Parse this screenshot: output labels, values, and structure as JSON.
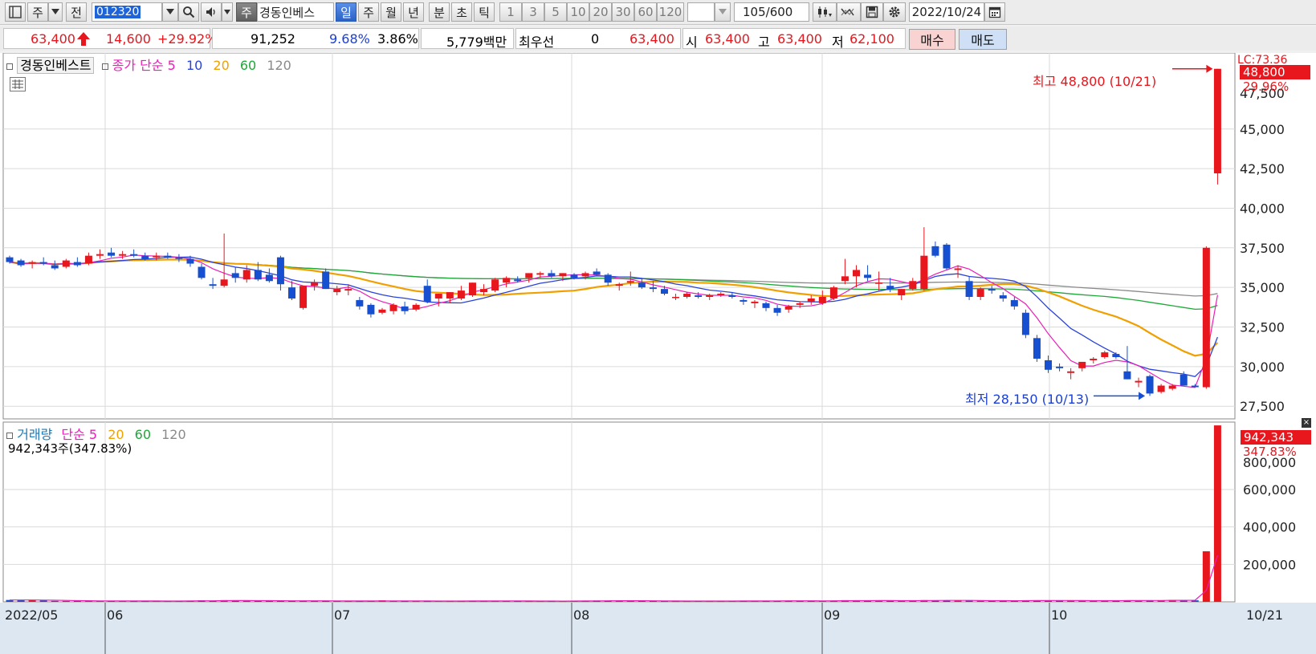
{
  "toolbar": {
    "market_type": "주",
    "scope": "전",
    "stock_code": "012320",
    "tag": "주",
    "stock_name": "경동인베스",
    "periods": [
      "일",
      "주",
      "월",
      "년",
      "분",
      "초",
      "틱"
    ],
    "active_period": "일",
    "intervals": [
      "1",
      "3",
      "5",
      "10",
      "20",
      "30",
      "60",
      "120"
    ],
    "count": "105",
    "max": "/600",
    "date": "2022/10/24"
  },
  "quote": {
    "price": "63,400",
    "change": "14,600",
    "change_pct": "+29.92%",
    "volume": "91,252",
    "vol_ratio": "9.68%",
    "turnover": "3.86%",
    "amount": "5,779백만",
    "best_label": "최우선",
    "best_value": "0",
    "bid_price": "63,400",
    "open_label": "시",
    "open": "63,400",
    "high_label": "고",
    "high": "63,400",
    "low_label": "저",
    "low": "62,100",
    "buy_label": "매수",
    "sell_label": "매도"
  },
  "price_panel": {
    "name": "경동인베스트",
    "ma_label": "종가 단순",
    "ma_periods": [
      "5",
      "10",
      "20",
      "60",
      "120"
    ],
    "high_annotation": "최고 48,800 (10/21)",
    "low_annotation": "최저 28,150 (10/13)",
    "axis_overflow_label": "LC:73.36",
    "badge_price": "48,800",
    "badge_pct": "29.96%"
  },
  "volume_panel": {
    "name": "거래량",
    "ma_label": "단순",
    "ma_periods": [
      "5",
      "20",
      "60",
      "120"
    ],
    "current": "942,343주(347.83%)",
    "badge_value": "942,343",
    "badge_pct": "347.83%"
  },
  "colors": {
    "up": "#e8161d",
    "down": "#1650d0",
    "ma5": "#e820b8",
    "ma10": "#2a44d8",
    "ma20": "#f0a000",
    "ma60": "#1fa838",
    "ma120": "#8a8a8a"
  },
  "chart_data": {
    "type": "candlestick",
    "price_axis": {
      "ticks": [
        27500,
        30000,
        32500,
        35000,
        37500,
        40000,
        42500,
        45000
      ],
      "top_partial_label": "47,500",
      "ylim": [
        26700,
        49800
      ]
    },
    "volume_axis": {
      "ticks": [
        200000,
        400000,
        600000
      ],
      "top_partial_label": "800,000",
      "ylim": [
        0,
        960000
      ]
    },
    "x_labels": [
      "2022/05",
      "06",
      "07",
      "08",
      "09",
      "10",
      "10/21"
    ],
    "candles": [
      {
        "o": 36900,
        "h": 37000,
        "l": 36500,
        "c": 36600
      },
      {
        "o": 36700,
        "h": 36800,
        "l": 36300,
        "c": 36400
      },
      {
        "o": 36500,
        "h": 36700,
        "l": 36200,
        "c": 36600
      },
      {
        "o": 36600,
        "h": 36900,
        "l": 36400,
        "c": 36500
      },
      {
        "o": 36400,
        "h": 36700,
        "l": 36100,
        "c": 36200
      },
      {
        "o": 36300,
        "h": 36800,
        "l": 36200,
        "c": 36700
      },
      {
        "o": 36600,
        "h": 36900,
        "l": 36300,
        "c": 36400
      },
      {
        "o": 36500,
        "h": 37200,
        "l": 36400,
        "c": 37000
      },
      {
        "o": 37000,
        "h": 37400,
        "l": 36800,
        "c": 37100
      },
      {
        "o": 37200,
        "h": 37500,
        "l": 36900,
        "c": 37000
      },
      {
        "o": 37000,
        "h": 37300,
        "l": 36800,
        "c": 37100
      },
      {
        "o": 37100,
        "h": 37400,
        "l": 36900,
        "c": 37000
      },
      {
        "o": 37000,
        "h": 37200,
        "l": 36700,
        "c": 36800
      },
      {
        "o": 36900,
        "h": 37200,
        "l": 36700,
        "c": 37000
      },
      {
        "o": 37000,
        "h": 37200,
        "l": 36800,
        "c": 36900
      },
      {
        "o": 36900,
        "h": 37100,
        "l": 36600,
        "c": 36800
      },
      {
        "o": 36800,
        "h": 37000,
        "l": 36300,
        "c": 36500
      },
      {
        "o": 36300,
        "h": 36500,
        "l": 35500,
        "c": 35600
      },
      {
        "o": 35200,
        "h": 35600,
        "l": 34900,
        "c": 35100
      },
      {
        "o": 35100,
        "h": 38400,
        "l": 35000,
        "c": 35500
      },
      {
        "o": 35900,
        "h": 36300,
        "l": 35300,
        "c": 35600
      },
      {
        "o": 35500,
        "h": 36400,
        "l": 35300,
        "c": 36100
      },
      {
        "o": 36100,
        "h": 36600,
        "l": 35400,
        "c": 35500
      },
      {
        "o": 35800,
        "h": 36200,
        "l": 35300,
        "c": 35400
      },
      {
        "o": 36900,
        "h": 37000,
        "l": 34800,
        "c": 35200
      },
      {
        "o": 35000,
        "h": 35400,
        "l": 34200,
        "c": 34300
      },
      {
        "o": 33700,
        "h": 35100,
        "l": 33600,
        "c": 35100
      },
      {
        "o": 35100,
        "h": 35500,
        "l": 34800,
        "c": 35300
      },
      {
        "o": 36000,
        "h": 36200,
        "l": 34900,
        "c": 34900
      },
      {
        "o": 34700,
        "h": 35100,
        "l": 34500,
        "c": 34900
      },
      {
        "o": 34800,
        "h": 35200,
        "l": 34500,
        "c": 34900
      },
      {
        "o": 34200,
        "h": 34400,
        "l": 33600,
        "c": 33800
      },
      {
        "o": 33900,
        "h": 34000,
        "l": 33100,
        "c": 33300
      },
      {
        "o": 33400,
        "h": 33700,
        "l": 33300,
        "c": 33600
      },
      {
        "o": 33500,
        "h": 34000,
        "l": 33300,
        "c": 33900
      },
      {
        "o": 33800,
        "h": 34100,
        "l": 33300,
        "c": 33500
      },
      {
        "o": 33600,
        "h": 34000,
        "l": 33500,
        "c": 33900
      },
      {
        "o": 35100,
        "h": 35500,
        "l": 34000,
        "c": 34100
      },
      {
        "o": 34300,
        "h": 34600,
        "l": 33800,
        "c": 34600
      },
      {
        "o": 34300,
        "h": 34700,
        "l": 34000,
        "c": 34700
      },
      {
        "o": 34300,
        "h": 35100,
        "l": 34200,
        "c": 34800
      },
      {
        "o": 34500,
        "h": 35300,
        "l": 34400,
        "c": 35300
      },
      {
        "o": 34700,
        "h": 35200,
        "l": 34500,
        "c": 34900
      },
      {
        "o": 34800,
        "h": 35600,
        "l": 34700,
        "c": 35500
      },
      {
        "o": 35300,
        "h": 35700,
        "l": 35000,
        "c": 35600
      },
      {
        "o": 35500,
        "h": 35700,
        "l": 35300,
        "c": 35400
      },
      {
        "o": 35600,
        "h": 35900,
        "l": 35300,
        "c": 35900
      },
      {
        "o": 35800,
        "h": 36000,
        "l": 35600,
        "c": 35900
      },
      {
        "o": 35900,
        "h": 36100,
        "l": 35600,
        "c": 35700
      },
      {
        "o": 35700,
        "h": 35900,
        "l": 35400,
        "c": 35900
      },
      {
        "o": 35800,
        "h": 35900,
        "l": 35500,
        "c": 35600
      },
      {
        "o": 35700,
        "h": 36000,
        "l": 35500,
        "c": 35900
      },
      {
        "o": 36000,
        "h": 36200,
        "l": 35700,
        "c": 35800
      },
      {
        "o": 35800,
        "h": 35900,
        "l": 35100,
        "c": 35300
      },
      {
        "o": 35100,
        "h": 35300,
        "l": 34800,
        "c": 35200
      },
      {
        "o": 35300,
        "h": 36000,
        "l": 35100,
        "c": 35400
      },
      {
        "o": 35300,
        "h": 35600,
        "l": 34900,
        "c": 35000
      },
      {
        "o": 35000,
        "h": 35400,
        "l": 34700,
        "c": 34900
      },
      {
        "o": 34900,
        "h": 35100,
        "l": 34500,
        "c": 34600
      },
      {
        "o": 34400,
        "h": 34600,
        "l": 34200,
        "c": 34400
      },
      {
        "o": 34400,
        "h": 34700,
        "l": 34300,
        "c": 34600
      },
      {
        "o": 34500,
        "h": 34700,
        "l": 34300,
        "c": 34400
      },
      {
        "o": 34400,
        "h": 34600,
        "l": 34200,
        "c": 34500
      },
      {
        "o": 34500,
        "h": 34700,
        "l": 34400,
        "c": 34600
      },
      {
        "o": 34500,
        "h": 34700,
        "l": 34300,
        "c": 34400
      },
      {
        "o": 34200,
        "h": 34300,
        "l": 33900,
        "c": 34100
      },
      {
        "o": 34000,
        "h": 34200,
        "l": 33700,
        "c": 34100
      },
      {
        "o": 34000,
        "h": 34100,
        "l": 33500,
        "c": 33700
      },
      {
        "o": 33700,
        "h": 33900,
        "l": 33200,
        "c": 33400
      },
      {
        "o": 33600,
        "h": 33900,
        "l": 33400,
        "c": 33800
      },
      {
        "o": 33900,
        "h": 34100,
        "l": 33700,
        "c": 34000
      },
      {
        "o": 34100,
        "h": 34500,
        "l": 33900,
        "c": 34300
      },
      {
        "o": 34000,
        "h": 34800,
        "l": 33900,
        "c": 34400
      },
      {
        "o": 34300,
        "h": 35100,
        "l": 34200,
        "c": 35000
      },
      {
        "o": 35400,
        "h": 36800,
        "l": 35200,
        "c": 35700
      },
      {
        "o": 35700,
        "h": 36400,
        "l": 35000,
        "c": 36100
      },
      {
        "o": 35800,
        "h": 36400,
        "l": 35400,
        "c": 35600
      },
      {
        "o": 35300,
        "h": 36000,
        "l": 34800,
        "c": 35300
      },
      {
        "o": 35100,
        "h": 35600,
        "l": 34700,
        "c": 34900
      },
      {
        "o": 34500,
        "h": 34900,
        "l": 34200,
        "c": 34900
      },
      {
        "o": 34900,
        "h": 35600,
        "l": 34800,
        "c": 35400
      },
      {
        "o": 34900,
        "h": 38800,
        "l": 34800,
        "c": 37000
      },
      {
        "o": 37600,
        "h": 37900,
        "l": 36900,
        "c": 37000
      },
      {
        "o": 37700,
        "h": 37800,
        "l": 36100,
        "c": 36200
      },
      {
        "o": 36100,
        "h": 36400,
        "l": 35600,
        "c": 36200
      },
      {
        "o": 35400,
        "h": 35700,
        "l": 34200,
        "c": 34400
      },
      {
        "o": 34400,
        "h": 35000,
        "l": 34200,
        "c": 34900
      },
      {
        "o": 34900,
        "h": 35100,
        "l": 34600,
        "c": 34800
      },
      {
        "o": 34500,
        "h": 34700,
        "l": 34100,
        "c": 34300
      },
      {
        "o": 34200,
        "h": 34400,
        "l": 33600,
        "c": 33800
      },
      {
        "o": 33400,
        "h": 33600,
        "l": 31800,
        "c": 32000
      },
      {
        "o": 31800,
        "h": 32000,
        "l": 30300,
        "c": 30500
      },
      {
        "o": 30400,
        "h": 30700,
        "l": 29600,
        "c": 29800
      },
      {
        "o": 30000,
        "h": 30200,
        "l": 29700,
        "c": 29900
      },
      {
        "o": 29600,
        "h": 29900,
        "l": 29200,
        "c": 29700
      },
      {
        "o": 29900,
        "h": 30300,
        "l": 29700,
        "c": 30300
      },
      {
        "o": 30400,
        "h": 30600,
        "l": 30200,
        "c": 30500
      },
      {
        "o": 30600,
        "h": 31000,
        "l": 30500,
        "c": 30900
      },
      {
        "o": 30800,
        "h": 30900,
        "l": 30500,
        "c": 30600
      },
      {
        "o": 29700,
        "h": 31300,
        "l": 29200,
        "c": 29200
      },
      {
        "o": 29000,
        "h": 29300,
        "l": 28700,
        "c": 29100
      },
      {
        "o": 29400,
        "h": 29500,
        "l": 28150,
        "c": 28300
      },
      {
        "o": 28400,
        "h": 28900,
        "l": 28300,
        "c": 28800
      },
      {
        "o": 28600,
        "h": 28900,
        "l": 28500,
        "c": 28800
      },
      {
        "o": 29500,
        "h": 29700,
        "l": 28800,
        "c": 28800
      },
      {
        "o": 28800,
        "h": 28900,
        "l": 28700,
        "c": 28700
      },
      {
        "o": 28700,
        "h": 37600,
        "l": 28600,
        "c": 37500
      },
      {
        "o": 42200,
        "h": 48800,
        "l": 41500,
        "c": 48800
      }
    ],
    "volume": [
      10000,
      10000,
      10000,
      8000,
      5000,
      5000,
      5000,
      6000,
      5000,
      5000,
      5000,
      4000,
      4000,
      5000,
      4000,
      4000,
      6000,
      8000,
      5000,
      9000,
      7000,
      6000,
      5000,
      5000,
      7000,
      5000,
      6000,
      5000,
      5000,
      5000,
      4000,
      4000,
      5000,
      8000,
      5000,
      4000,
      4000,
      4000,
      5000,
      4000,
      4000,
      6000,
      5000,
      5000,
      5000,
      4000,
      4000,
      4000,
      4000,
      4000,
      5000,
      6000,
      7000,
      6000,
      5000,
      6000,
      5000,
      5000,
      4000,
      4000,
      4000,
      5000,
      4000,
      4000,
      5000,
      5000,
      5000,
      6000,
      5000,
      6000,
      5000,
      5000,
      5000,
      6000,
      9000,
      7000,
      6000,
      6000,
      6000,
      7000,
      7000,
      9000,
      8000,
      7000,
      7000,
      7000,
      6000,
      6000,
      6000,
      6000,
      8000,
      8000,
      7000,
      7000,
      7000,
      6000,
      6000,
      7000,
      7000,
      8000,
      7000,
      8000,
      7000,
      10000,
      9000,
      8000,
      270000,
      942343
    ]
  }
}
